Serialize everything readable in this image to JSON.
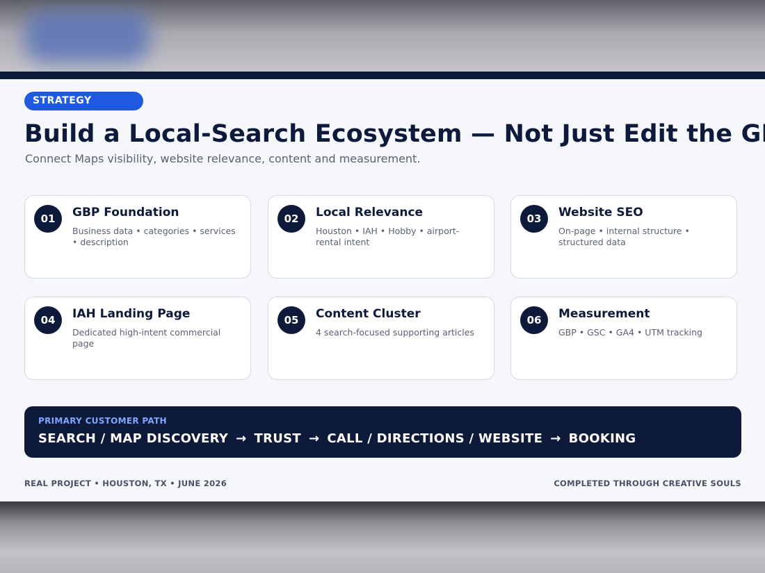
{
  "slide": {
    "tag": "STRATEGY",
    "title": "Build a Local-Search Ecosystem — Not Just Edit the GBP",
    "subtitle": "Connect Maps visibility, website relevance, content and measurement."
  },
  "cards": [
    {
      "number": "01",
      "title": "GBP Foundation",
      "description": "Business data • categories • services • description"
    },
    {
      "number": "02",
      "title": "Local Relevance",
      "description": "Houston • IAH • Hobby • airport-rental intent"
    },
    {
      "number": "03",
      "title": "Website SEO",
      "description": "On-page • internal structure • structured data"
    },
    {
      "number": "04",
      "title": "IAH Landing Page",
      "description": "Dedicated high-intent commercial page"
    },
    {
      "number": "05",
      "title": "Content Cluster",
      "description": "4 search-focused supporting articles"
    },
    {
      "number": "06",
      "title": "Measurement",
      "description": "GBP • GSC • GA4 • UTM tracking"
    }
  ],
  "customer_path": {
    "label": "PRIMARY CUSTOMER PATH",
    "steps": [
      "SEARCH / MAP DISCOVERY",
      "TRUST",
      "CALL / DIRECTIONS / WEBSITE",
      "BOOKING"
    ],
    "arrow": "→"
  },
  "footer": {
    "left": "REAL PROJECT • HOUSTON, TX • JUNE 2026",
    "right": "COMPLETED THROUGH CREATIVE SOULS"
  },
  "colors": {
    "navy": "#0e1a3a",
    "accent_blue": "#1d5ae0",
    "path_label": "#7fa7ff",
    "muted_text": "#5a6172"
  }
}
